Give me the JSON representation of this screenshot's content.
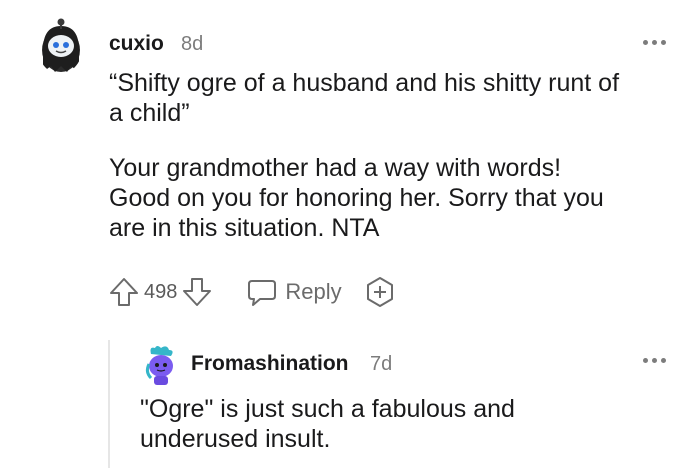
{
  "comment": {
    "username": "cuxio",
    "time": "8d",
    "quote": "“Shifty ogre of a husband and his shitty runt of\na child”",
    "body": "Your grandmother had a way with words!\nGood on you for honoring her. Sorry that you\nare in this situation. NTA",
    "score": "498",
    "reply_label": "Reply"
  },
  "reply": {
    "username": "Fromashination",
    "time": "7d",
    "body": "\"Ogre\" is just such a fabulous and\nunderused insult."
  },
  "icons": {
    "upvote": "arrow-up-icon",
    "downvote": "arrow-down-icon",
    "reply": "speech-bubble-icon",
    "award": "award-plus-icon",
    "more": "more-horizontal-icon"
  },
  "colors": {
    "text": "#1a1a1b",
    "meta": "#7c7c7c",
    "action": "#6b6b6b",
    "snoo_reply": "#7b5cf0"
  }
}
